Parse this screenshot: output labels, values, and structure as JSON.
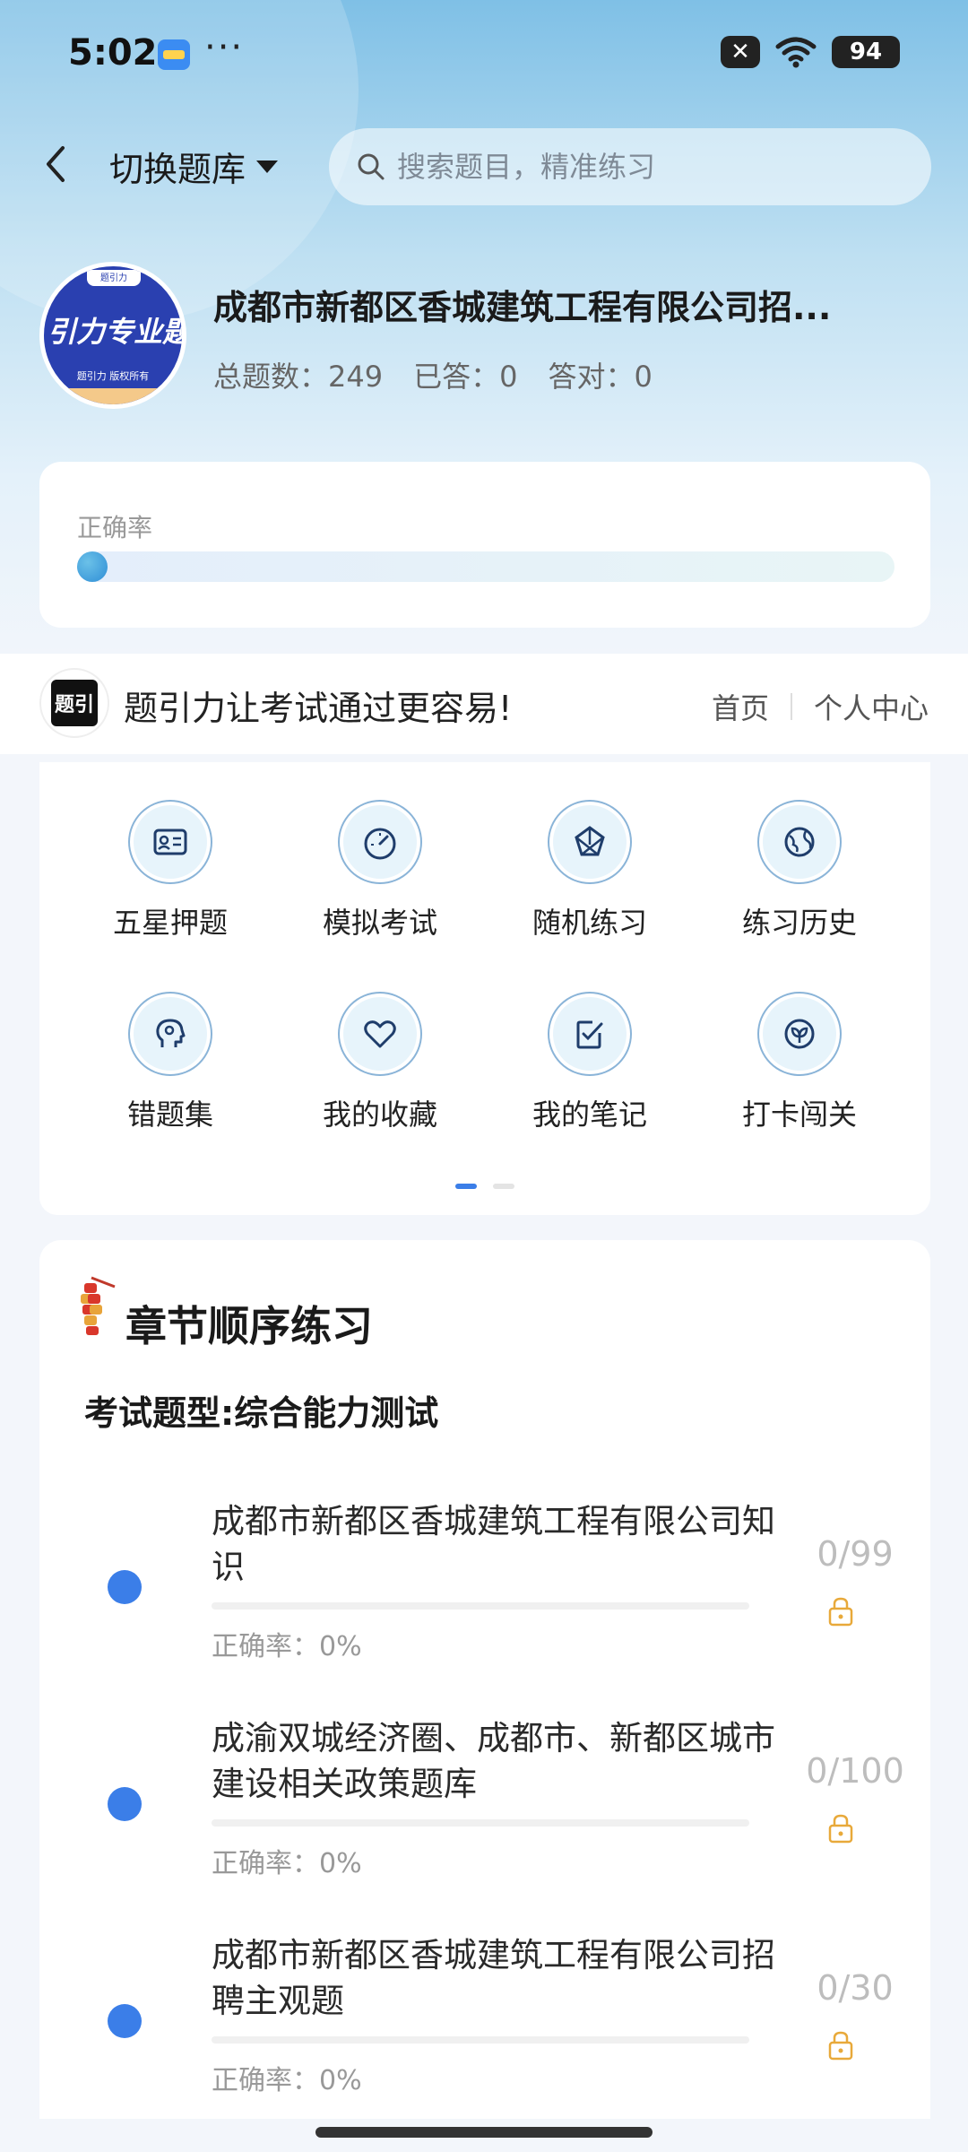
{
  "status_bar": {
    "time": "5:02",
    "dots": "···",
    "battery": "94"
  },
  "header": {
    "switch_label": "切换题库",
    "search_placeholder": "搜索题目，精准练习"
  },
  "bank": {
    "logo_main": "引力专业题",
    "logo_sub": "题引力 版权所有",
    "logo_tag": "题引力",
    "title": "成都市新都区香城建筑工程有限公司招...",
    "stats": {
      "total": "总题数：249",
      "answered": "已答：0",
      "correct": "答对：0"
    }
  },
  "accuracy": {
    "label": "正确率",
    "value": 0
  },
  "banner": {
    "logo_text": "题引",
    "slogan": "题引力让考试通过更容易!",
    "nav": [
      "首页",
      "个人中心"
    ]
  },
  "features": [
    {
      "label": "五星押题",
      "icon": "id-card-icon"
    },
    {
      "label": "模拟考试",
      "icon": "gauge-icon"
    },
    {
      "label": "随机练习",
      "icon": "shuffle-icon"
    },
    {
      "label": "练习历史",
      "icon": "globe-icon"
    },
    {
      "label": "错题集",
      "icon": "head-icon"
    },
    {
      "label": "我的收藏",
      "icon": "heart-icon"
    },
    {
      "label": "我的笔记",
      "icon": "note-icon"
    },
    {
      "label": "打卡闯关",
      "icon": "leaf-icon"
    }
  ],
  "pager": {
    "pages": 2,
    "current": 1
  },
  "chapter": {
    "title": "章节顺序练习",
    "exam_type": "考试题型:综合能力测试",
    "items": [
      {
        "title": "成都市新都区香城建筑工程有限公司知识",
        "accuracy": "正确率：0%",
        "count": "0/99"
      },
      {
        "title": "成渝双城经济圈、成都市、新都区城市建设相关政策题库",
        "accuracy": "正确率：0%",
        "count": "0/100"
      },
      {
        "title": "成都市新都区香城建筑工程有限公司招聘主观题",
        "accuracy": "正确率：0%",
        "count": "0/30"
      }
    ]
  },
  "colors": {
    "accent": "#3b7ee8",
    "lock": "#e8a93a"
  }
}
